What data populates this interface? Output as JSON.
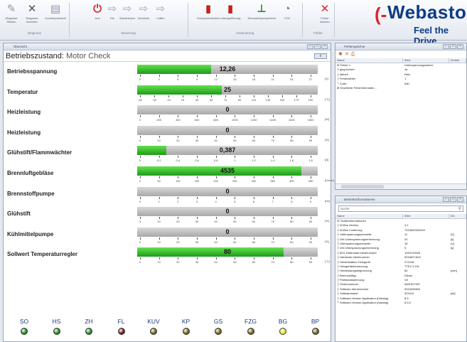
{
  "ribbon": {
    "buttons": [
      {
        "label": "Diagnose Starten",
        "icon": "wrench-icon",
        "color": "#8c96a8"
      },
      {
        "label": "Diagnose beenden",
        "icon": "close-x-icon",
        "color": "#4a5364"
      },
      {
        "label": "Kundenprotokoll",
        "icon": "document-icon",
        "color": "#8c96a8"
      },
      {
        "label": "Aus",
        "icon": "stop-icon",
        "color": "#d8262c"
      },
      {
        "label": "Ein",
        "icon": "arrow-icon",
        "color": "#b0b8c6"
      },
      {
        "label": "Standheizen",
        "icon": "arrow-icon",
        "color": "#b0b8c6"
      },
      {
        "label": "Zuheizen",
        "icon": "arrow-icon",
        "color": "#b0b8c6"
      },
      {
        "label": "Lüften",
        "icon": "arrow-icon",
        "color": "#b0b8c6"
      },
      {
        "label": "Komponententest",
        "icon": "component-icon",
        "color": "#c8201e"
      },
      {
        "label": "Leitungsführung",
        "icon": "component-icon",
        "color": "#c8201e"
      },
      {
        "label": "Stromstoßpumpentest",
        "icon": "pump-icon",
        "color": "#2f8a2a"
      },
      {
        "label": "CO2",
        "icon": "gauge-icon",
        "color": "#6a7688"
      },
      {
        "label": "Fehler löschen",
        "icon": "delete-x-icon",
        "color": "#d8262c"
      }
    ],
    "groups": [
      "Diagnose",
      "Steuerung",
      "Ansteuerung",
      "Fehler"
    ],
    "logo": {
      "text": "Webasto",
      "slogan": "Feel the Drive"
    }
  },
  "main": {
    "window_title": "Übersicht",
    "status_label": "Betriebszustand:",
    "status_value": "Motor Check",
    "status_button": "⇧",
    "gauges": [
      {
        "label": "Betriebsspannung",
        "value": "12,26",
        "fill": 0.41,
        "ticks": [
          "0",
          "3",
          "6",
          "9",
          "12",
          "15",
          "18",
          "21",
          "24",
          "27"
        ],
        "unit": "[V]"
      },
      {
        "label": "Temperatur",
        "value": "25",
        "fill": 0.47,
        "ticks": [
          "-50",
          "-30",
          "-10",
          "10",
          "30",
          "50",
          "70",
          "90",
          "110",
          "130",
          "150",
          "170",
          "190"
        ],
        "unit": "[°C]"
      },
      {
        "label": "Heizleistung",
        "value": "0",
        "fill": 0.0,
        "ticks": [
          "0",
          "200",
          "400",
          "600",
          "800",
          "1000",
          "1200",
          "1400",
          "1600",
          "1800"
        ],
        "unit": "[W]"
      },
      {
        "label": "Heizleistung",
        "value": "0",
        "fill": 0.0,
        "ticks": [
          "0",
          "10",
          "20",
          "30",
          "40",
          "50",
          "60",
          "70",
          "80",
          "90"
        ],
        "unit": "[%]"
      },
      {
        "label": "Glühstift/Flammwächter",
        "value": "0,387",
        "fill": 0.16,
        "ticks": [
          "0",
          "0.2",
          "0.4",
          "0.6",
          "0.8",
          "1",
          "1.2",
          "1.4",
          "1.6",
          "1.8"
        ],
        "unit": "[Ω]"
      },
      {
        "label": "Brennluftgebläse",
        "value": "4535",
        "fill": 0.91,
        "ticks": [
          "0",
          "50",
          "100",
          "150",
          "200",
          "250",
          "300",
          "350",
          "400",
          "450"
        ],
        "unit": "[U/min]"
      },
      {
        "label": "Brennstoffpumpe",
        "value": "0",
        "fill": 0.0,
        "ticks": [
          "0",
          "1",
          "2",
          "3",
          "4",
          "5",
          "6",
          "7",
          "8",
          "9"
        ],
        "unit": "[Hz]"
      },
      {
        "label": "Glühstift",
        "value": "0",
        "fill": 0.0,
        "ticks": [
          "0",
          "10",
          "20",
          "30",
          "40",
          "50",
          "60",
          "70",
          "80",
          "90"
        ],
        "unit": "[%]"
      },
      {
        "label": "Kühlmittelpumpe",
        "value": "0",
        "fill": 0.0,
        "ticks": [
          "0",
          "10",
          "20",
          "30",
          "40",
          "50",
          "60",
          "70",
          "80",
          "90"
        ],
        "unit": "[%]"
      },
      {
        "label": "Sollwert Temperaturregler",
        "value": "80",
        "fill": 0.81,
        "ticks": [
          "0",
          "10",
          "20",
          "30",
          "40",
          "50",
          "60",
          "70",
          "80",
          "90"
        ],
        "unit": "[°C]"
      }
    ],
    "leds": [
      {
        "label": "SO",
        "color": "#1e8a1e"
      },
      {
        "label": "HS",
        "color": "#1e8a1e"
      },
      {
        "label": "ZH",
        "color": "#1e8a1e"
      },
      {
        "label": "FL",
        "color": "#7a1418"
      },
      {
        "label": "KUV",
        "color": "#6e6410"
      },
      {
        "label": "KP",
        "color": "#6e6410"
      },
      {
        "label": "GS",
        "color": "#6e6410"
      },
      {
        "label": "FZG",
        "color": "#6e6410"
      },
      {
        "label": "BG",
        "color": "#e8e030"
      },
      {
        "label": "BP",
        "color": "#6e6410"
      }
    ]
  },
  "errors_panel": {
    "title": "Fehlerspeicher",
    "columns": [
      "Name",
      "Wert",
      "Einheit"
    ],
    "rows": [
      {
        "name": "⊟ Fehler 1",
        "value": "Unterspannungsabsch.",
        "unit": ""
      },
      {
        "name": "   ├ gespeichert",
        "value": "Ja",
        "unit": ""
      },
      {
        "name": "   ├ aktuell",
        "value": "Nein",
        "unit": ""
      },
      {
        "name": "   ├ Fehlerzähler",
        "value": "1",
        "unit": ""
      },
      {
        "name": "   └ Code",
        "value": "5dh",
        "unit": ""
      },
      {
        "name": "⊞ Erweiterte Fehlerinformatio...",
        "value": "",
        "unit": ""
      }
    ]
  },
  "info_panel": {
    "title": "Betriebsinformationen",
    "search_placeholder": "Suche",
    "columns": [
      "Name",
      "Wert",
      "Ein"
    ],
    "rows": [
      {
        "name": "⊟ Geräteinformationen",
        "value": "",
        "unit": ""
      },
      {
        "name": "  ├ W-Bus Version",
        "value": "4.1",
        "unit": ""
      },
      {
        "name": "  ├ W-Bus Codierung",
        "value": "7913642004000",
        "unit": ""
      },
      {
        "name": "  ├ Unterspannungsschwelle",
        "value": "11",
        "unit": "[V]"
      },
      {
        "name": "  ├ Zeit Unterspannungserkennung",
        "value": "20",
        "unit": "[s]"
      },
      {
        "name": "  ├ Überspannungsschwelle",
        "value": "16",
        "unit": "[V]"
      },
      {
        "name": "  ├ Zeit Überspannungserkennung",
        "value": "5",
        "unit": "[s]"
      },
      {
        "name": "  ├ BOL Datensatz-Identnummer",
        "value": "1094743026",
        "unit": ""
      },
      {
        "name": "  ├ Hardware Identnummer",
        "value": "9016627A03",
        "unit": ""
      },
      {
        "name": "  ├ Herstelldatum Heizgerät",
        "value": "27/10/8",
        "unit": ""
      },
      {
        "name": "  ├ Heizgerätebenennung",
        "value": "TTEV 5 10L",
        "unit": ""
      },
      {
        "name": "  ├ Heizleistungsbegrenzung",
        "value": "60",
        "unit": "[min]"
      },
      {
        "name": "  ├ Brennstofftyp",
        "value": "Diesel",
        "unit": ""
      },
      {
        "name": "  ├ Prüfstandskennung",
        "value": "V5",
        "unit": ""
      },
      {
        "name": "  ├ Seriennummer",
        "value": "0851527057",
        "unit": ""
      },
      {
        "name": "  ├ Software Identnummer",
        "value": "9024045603",
        "unit": ""
      },
      {
        "name": "  ├ Softwarestand",
        "value": "3/24/10",
        "unit": "[kd]"
      },
      {
        "name": "  ├ Software-Version Applikation (Datalog)",
        "value": "8.5",
        "unit": ""
      },
      {
        "name": "  └ Software-Version Applikation (Datalog)",
        "value": "8.5.0",
        "unit": ""
      }
    ]
  }
}
